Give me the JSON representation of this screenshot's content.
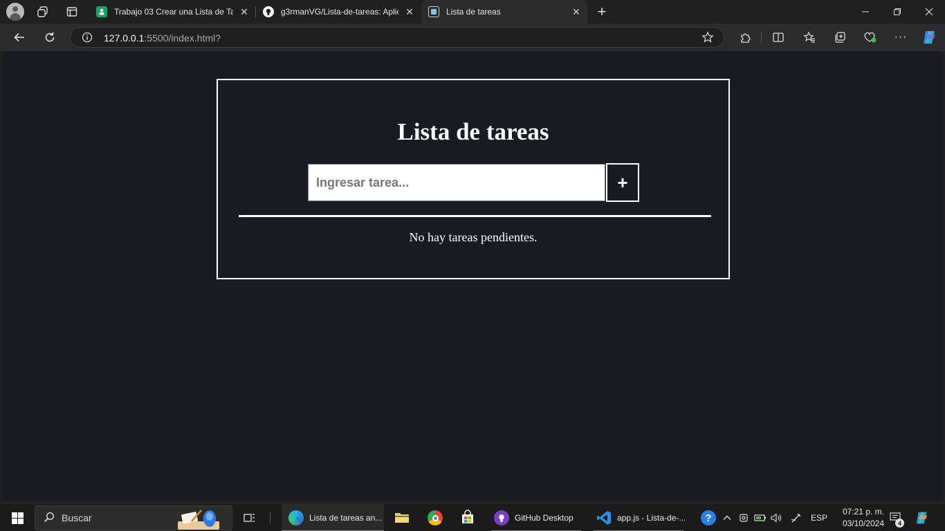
{
  "browser": {
    "tabs": [
      {
        "title": "Trabajo 03 Crear una Lista de Tare",
        "favicon": "classroom-icon"
      },
      {
        "title": "g3rmanVG/Lista-de-tareas: Aplica",
        "favicon": "github-icon"
      },
      {
        "title": "Lista de tareas",
        "favicon": "page-icon",
        "active": true
      }
    ],
    "new_tab_label": "+",
    "url_host": "127.0.0.1",
    "url_rest": ":5500/index.html?"
  },
  "page": {
    "title": "Lista de tareas",
    "input_placeholder": "Ingresar tarea...",
    "input_value": "",
    "add_button_label": "+",
    "empty_message": "No hay tareas pendientes."
  },
  "taskbar": {
    "search_placeholder": "Buscar",
    "apps": [
      {
        "label": "Lista de tareas an...",
        "icon": "edge-icon",
        "state": "active"
      },
      {
        "label": "",
        "icon": "file-explorer-icon"
      },
      {
        "label": "",
        "icon": "chrome-icon"
      },
      {
        "label": "",
        "icon": "microsoft-store-icon"
      },
      {
        "label": "GitHub Desktop",
        "icon": "github-desktop-icon",
        "state": "open"
      },
      {
        "label": "app.js - Lista-de-...",
        "icon": "vscode-icon",
        "state": "open"
      }
    ],
    "language": "ESP",
    "time": "07:21 p. m.",
    "date": "03/10/2024",
    "notification_count": "4"
  },
  "colors": {
    "page_background": "#1a1a23",
    "card_border": "#ffffff",
    "input_background": "#ffffff",
    "taskbar_accent": "#4f8fd9"
  }
}
